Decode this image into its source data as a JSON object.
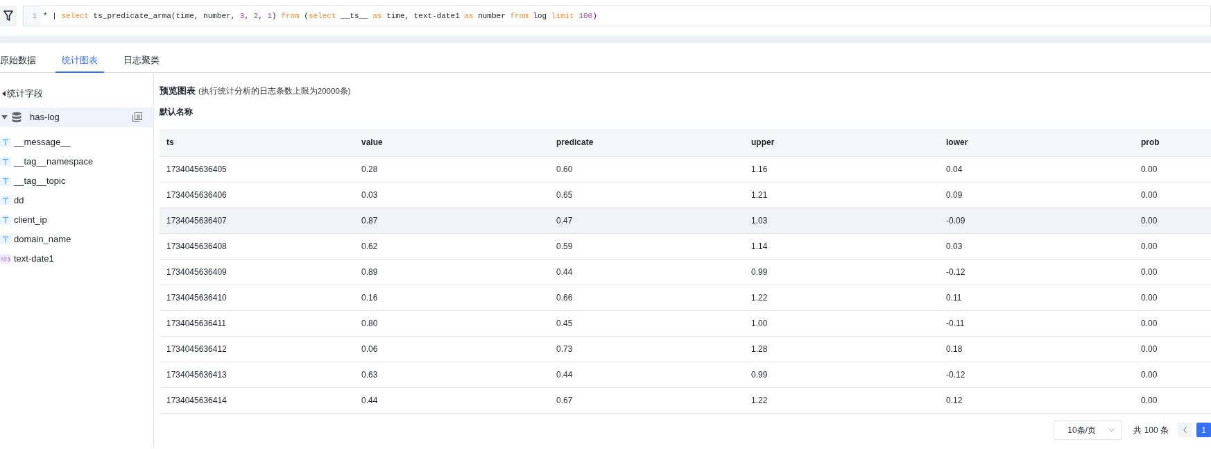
{
  "query": {
    "line_number": "1",
    "tokens": [
      {
        "kind": "plain",
        "text": "* | "
      },
      {
        "kind": "keyword",
        "text": "select"
      },
      {
        "kind": "plain",
        "text": " ts_predicate_arma(time, number, "
      },
      {
        "kind": "number",
        "text": "3"
      },
      {
        "kind": "plain",
        "text": ", "
      },
      {
        "kind": "number",
        "text": "2"
      },
      {
        "kind": "plain",
        "text": ", "
      },
      {
        "kind": "number",
        "text": "1"
      },
      {
        "kind": "plain",
        "text": ") "
      },
      {
        "kind": "keyword",
        "text": "from"
      },
      {
        "kind": "plain",
        "text": " ("
      },
      {
        "kind": "keyword",
        "text": "select"
      },
      {
        "kind": "plain",
        "text": " __ts__ "
      },
      {
        "kind": "keyword",
        "text": "as"
      },
      {
        "kind": "plain",
        "text": " time, text-date1 "
      },
      {
        "kind": "keyword",
        "text": "as"
      },
      {
        "kind": "plain",
        "text": " number "
      },
      {
        "kind": "keyword",
        "text": "from"
      },
      {
        "kind": "plain",
        "text": " log "
      },
      {
        "kind": "keyword",
        "text": "limit "
      },
      {
        "kind": "number",
        "text": "100"
      },
      {
        "kind": "plain",
        "text": ")"
      }
    ]
  },
  "tabs": [
    {
      "label": "原始数据",
      "selected": false
    },
    {
      "label": "统计图表",
      "selected": true
    },
    {
      "label": "日志聚类",
      "selected": false
    }
  ],
  "sidebar": {
    "title": "统计字段",
    "source": {
      "name": "has-log",
      "expanded": true
    },
    "fields": [
      {
        "kind": "text",
        "name": "__message__"
      },
      {
        "kind": "text",
        "name": "__tag__namespace"
      },
      {
        "kind": "text",
        "name": "__tag__topic"
      },
      {
        "kind": "text",
        "name": "dd"
      },
      {
        "kind": "text",
        "name": "client_ip"
      },
      {
        "kind": "text",
        "name": "domain_name"
      },
      {
        "kind": "number",
        "name": "text-date1"
      }
    ]
  },
  "preview": {
    "title": "预览图表",
    "note": "(执行统计分析的日志条数上限为20000条)",
    "name": "默认名称"
  },
  "table": {
    "columns": [
      "ts",
      "value",
      "predicate",
      "upper",
      "lower",
      "prob"
    ],
    "rows": [
      {
        "hovered": false,
        "cells": [
          "1734045636405",
          "0.28",
          "0.60",
          "1.16",
          "0.04",
          "0.00"
        ]
      },
      {
        "hovered": false,
        "cells": [
          "1734045636406",
          "0.03",
          "0.65",
          "1.21",
          "0.09",
          "0.00"
        ]
      },
      {
        "hovered": true,
        "cells": [
          "1734045636407",
          "0.87",
          "0.47",
          "1.03",
          "-0.09",
          "0.00"
        ]
      },
      {
        "hovered": false,
        "cells": [
          "1734045636408",
          "0.62",
          "0.59",
          "1.14",
          "0.03",
          "0.00"
        ]
      },
      {
        "hovered": false,
        "cells": [
          "1734045636409",
          "0.89",
          "0.44",
          "0.99",
          "-0.12",
          "0.00"
        ]
      },
      {
        "hovered": false,
        "cells": [
          "1734045636410",
          "0.16",
          "0.66",
          "1.22",
          "0.11",
          "0.00"
        ]
      },
      {
        "hovered": false,
        "cells": [
          "1734045636411",
          "0.80",
          "0.45",
          "1.00",
          "-0.11",
          "0.00"
        ]
      },
      {
        "hovered": false,
        "cells": [
          "1734045636412",
          "0.06",
          "0.73",
          "1.28",
          "0.18",
          "0.00"
        ]
      },
      {
        "hovered": false,
        "cells": [
          "1734045636413",
          "0.63",
          "0.44",
          "0.99",
          "-0.12",
          "0.00"
        ]
      },
      {
        "hovered": false,
        "cells": [
          "1734045636414",
          "0.44",
          "0.67",
          "1.22",
          "0.12",
          "0.00"
        ]
      }
    ]
  },
  "pagination": {
    "page_size": "10条/页",
    "total": "共 100 条",
    "pages": [
      {
        "label": "1",
        "selected": true
      }
    ]
  }
}
